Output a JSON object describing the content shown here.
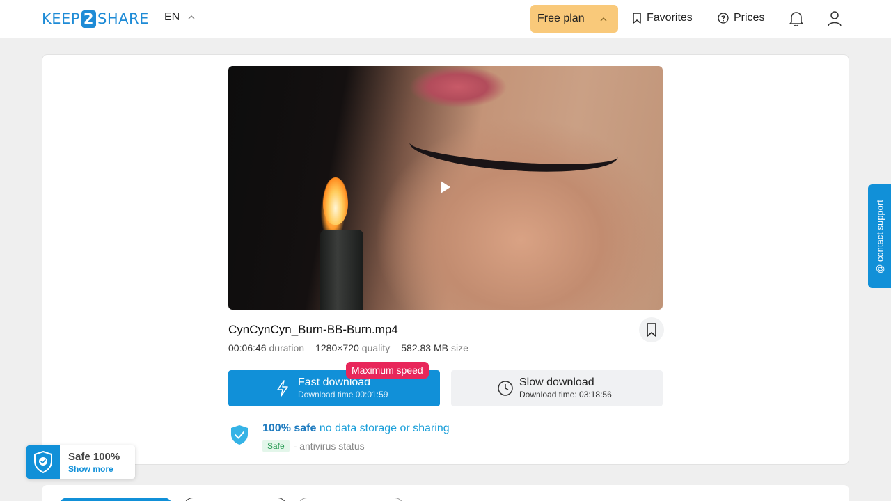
{
  "header": {
    "logo_left": "KEEP",
    "logo_mid": "2",
    "logo_right": "SHARE",
    "language": "EN",
    "plan_label": "Free plan",
    "favorites_label": "Favorites",
    "prices_label": "Prices"
  },
  "file": {
    "name": "CynCynCyn_Burn-BB-Burn.mp4",
    "duration_value": "00:06:46",
    "duration_label": "duration",
    "quality_value": "1280×720",
    "quality_label": "quality",
    "size_value": "582.83 MB",
    "size_label": "size"
  },
  "download": {
    "badge": "Maximum speed",
    "fast_title": "Fast download",
    "fast_sub": "Download time 00:01:59",
    "slow_title": "Slow download",
    "slow_sub": "Download time: 03:18:56"
  },
  "safety": {
    "strong": "100% safe",
    "rest": "no data storage or sharing",
    "tag": "Safe",
    "status": "- antivirus status"
  },
  "support": {
    "label": "@ contact support"
  },
  "safe_widget": {
    "title": "Safe 100%",
    "link": "Show more"
  },
  "colors": {
    "accent": "#1190d8",
    "plan": "#f9c97a",
    "badge": "#e8265a"
  }
}
